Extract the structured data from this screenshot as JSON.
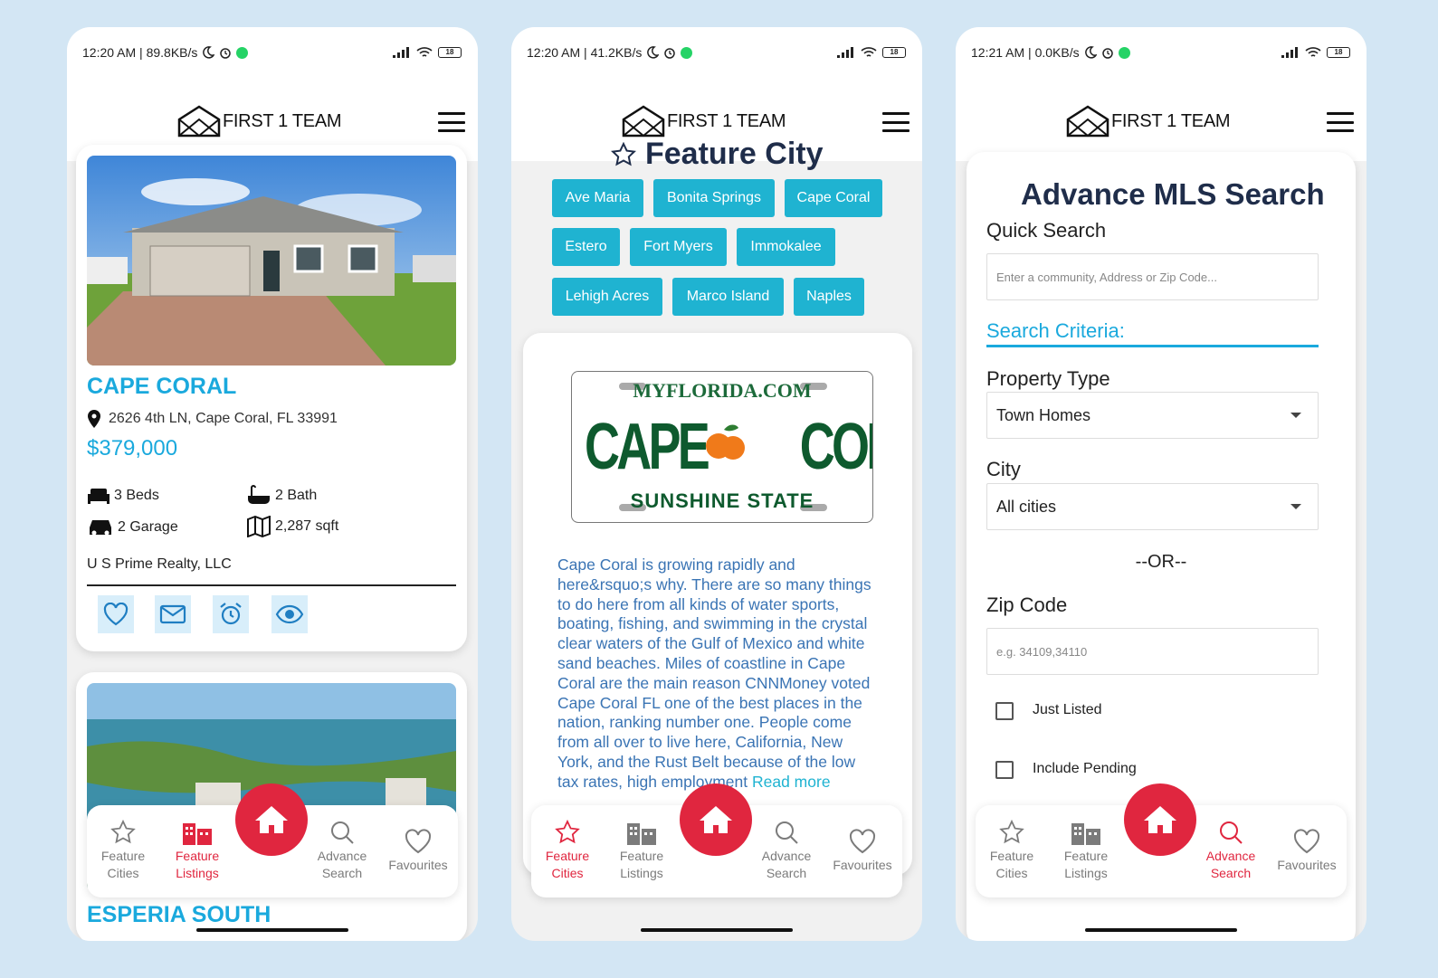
{
  "app": {
    "brand": "FIRST 1 TEAM"
  },
  "nav": {
    "feature_cities": "Feature Cities",
    "feature_listings": "Feature Listings",
    "advance_search": "Advance Search",
    "favourites": "Favourites",
    "active_color": "#e0263f"
  },
  "phone1": {
    "status": {
      "time": "12:20 AM | 89.8KB/s",
      "battery": "18"
    },
    "listing": {
      "city": "CAPE CORAL",
      "address": "2626 4th LN, Cape Coral, FL 33991",
      "price": "$379,000",
      "beds": "3 Beds",
      "bath": "2 Bath",
      "garage": "2 Garage",
      "sqft": "2,287 sqft",
      "broker": "U S Prime Realty, LLC"
    },
    "next_listing_city": "ESPERIA SOUTH",
    "active_tab": "Feature Listings"
  },
  "phone2": {
    "status": {
      "time": "12:20 AM | 41.2KB/s",
      "battery": "18"
    },
    "title": "Feature City",
    "cities": [
      "Ave Maria",
      "Bonita Springs",
      "Cape Coral",
      "Estero",
      "Fort Myers",
      "Immokalee",
      "Lehigh Acres",
      "Marco Island",
      "Naples"
    ],
    "plate": {
      "top": "MYFLORIDA.COM",
      "main_left": "CAPE",
      "main_right": "CORAL",
      "bottom": "SUNSHINE STATE"
    },
    "description": "Cape Coral is growing rapidly and here&rsquo;s why. There are so many things to do here from all kinds of water sports, boating, fishing, and swimming in the crystal clear waters of the Gulf of Mexico and white sand beaches. Miles of coastline in Cape Coral are the main reason CNNMoney voted Cape Coral FL one of the best places in the nation, ranking number one. People come from all over to live here, California, New York, and the Rust Belt because of the low tax rates, high employment",
    "read_more": "Read more",
    "active_tab": "Feature Cities"
  },
  "phone3": {
    "status": {
      "time": "12:21 AM | 0.0KB/s",
      "battery": "18"
    },
    "title": "Advance MLS Search",
    "quick_search_label": "Quick Search",
    "quick_search_placeholder": "Enter a community, Address or Zip Code...",
    "criteria_label": "Search Criteria:",
    "property_type_label": "Property Type",
    "property_type_value": "Town Homes",
    "city_label": "City",
    "city_value": "All cities",
    "or_text": "--OR--",
    "zip_label": "Zip Code",
    "zip_placeholder": "e.g. 34109,34110",
    "just_listed": "Just Listed",
    "include_pending": "Include Pending",
    "active_tab": "Advance Search"
  }
}
